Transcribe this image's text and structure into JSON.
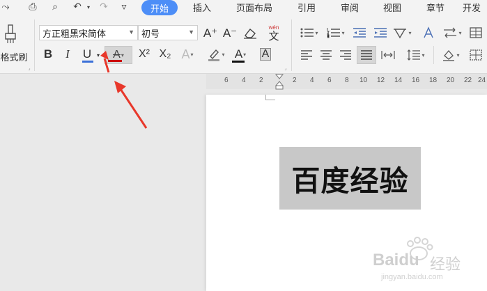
{
  "quick_access": [
    {
      "name": "redo-alt-icon",
      "glyph": "⤳"
    },
    {
      "name": "print-icon",
      "glyph": "⎙"
    },
    {
      "name": "print-preview-icon",
      "glyph": "⌕"
    },
    {
      "name": "undo-icon",
      "glyph": "↶"
    },
    {
      "name": "redo-icon",
      "glyph": "↷"
    },
    {
      "name": "customize-icon",
      "glyph": "▿"
    }
  ],
  "tabs": [
    {
      "label": "开始",
      "active": true
    },
    {
      "label": "插入"
    },
    {
      "label": "页面布局"
    },
    {
      "label": "引用"
    },
    {
      "label": "审阅"
    },
    {
      "label": "视图"
    },
    {
      "label": "章节"
    },
    {
      "label": "开发"
    }
  ],
  "ribbon": {
    "format_painter_label": "格式刷",
    "font_name": "方正粗黑宋简体",
    "font_size": "初号",
    "bold": "B",
    "italic": "I",
    "underline": "U",
    "strike_letter": "A",
    "superscript": "X²",
    "subscript": "X₂",
    "text_effect": "A",
    "font_color": "A",
    "char_shading": "A",
    "grow_font": "A⁺",
    "shrink_font": "A⁻",
    "phonetic": "文",
    "phonetic_top": "wén"
  },
  "ruler_left": [
    "6",
    "4",
    "2"
  ],
  "ruler_right": [
    "2",
    "4",
    "6",
    "8",
    "10",
    "12",
    "14",
    "16",
    "18",
    "20",
    "22",
    "24"
  ],
  "document": {
    "heading": "百度经验"
  },
  "watermark": {
    "brand": "Baidu",
    "sub": "经验",
    "url": "jingyan.baidu.com"
  },
  "colors": {
    "accent": "#4d8ef7",
    "underline_color": "#3a6fd8",
    "font_color_bar": "#cc0000",
    "arrow_red": "#e8382b",
    "heading_highlight": "#c8c8c8"
  }
}
